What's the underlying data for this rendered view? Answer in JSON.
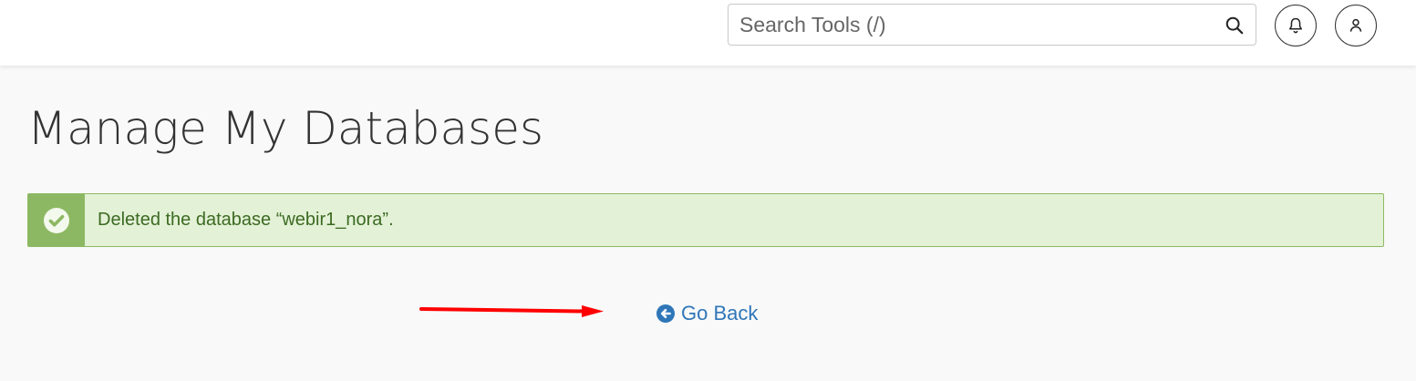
{
  "header": {
    "search": {
      "placeholder": "Search Tools (/)",
      "value": ""
    },
    "icons": {
      "search": "search-icon",
      "notifications": "bell-icon",
      "account": "user-icon"
    }
  },
  "main": {
    "title": "Manage My Databases",
    "alert": {
      "status": "success",
      "icon": "check-circle-icon",
      "message": "Deleted the database “webir1_nora”."
    },
    "go_back": {
      "icon": "arrow-left-circle-icon",
      "label": "Go Back"
    },
    "annotation": {
      "type": "arrow",
      "color": "#ff0000"
    }
  },
  "colors": {
    "success_bg": "#e3f1d6",
    "success_border": "#8cba63",
    "success_icon_bg": "#8db863",
    "success_text": "#3c6a23",
    "link": "#2f76b8",
    "annotation": "#ff0000"
  }
}
